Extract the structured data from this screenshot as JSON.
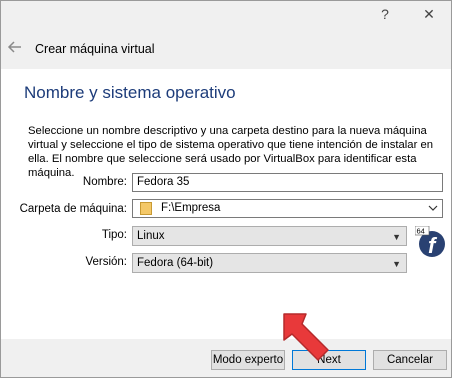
{
  "window": {
    "title": "Crear máquina virtual",
    "help_glyph": "?",
    "close_glyph": "✕"
  },
  "page": {
    "heading": "Nombre y sistema operativo",
    "description": "Seleccione un nombre descriptivo y una carpeta destino para la nueva máquina virtual y seleccione el tipo de sistema operativo que tiene intención de instalar en ella. El nombre que seleccione será usado por VirtualBox para identificar esta máquina."
  },
  "form": {
    "name_label": "Nombre:",
    "name_value": "Fedora 35",
    "folder_label": "Carpeta de máquina:",
    "folder_value": "F:\\Empresa",
    "type_label": "Tipo:",
    "type_value": "Linux",
    "version_label": "Versión:",
    "version_value": "Fedora (64-bit)"
  },
  "os_icon": {
    "badge": "64",
    "letter": "f"
  },
  "buttons": {
    "expert": "Modo experto",
    "next": "Next",
    "cancel": "Cancelar"
  },
  "colors": {
    "heading": "#1d3c7a",
    "pointer": "#e8393a",
    "fedora": "#294172"
  }
}
